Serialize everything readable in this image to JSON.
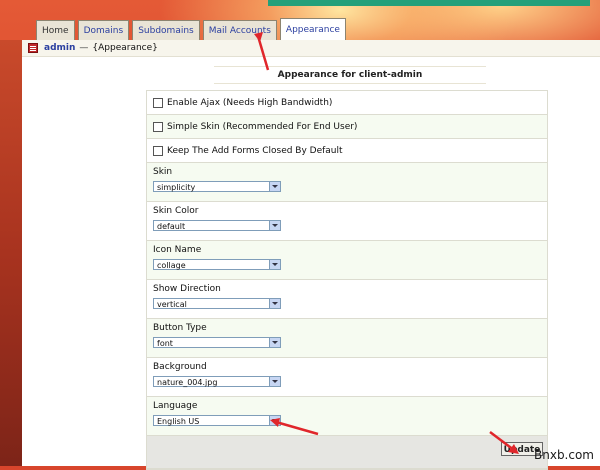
{
  "tabs": [
    {
      "label": "Home"
    },
    {
      "label": "Domains"
    },
    {
      "label": "Subdomains"
    },
    {
      "label": "Mail Accounts"
    },
    {
      "label": "Appearance",
      "active": true
    }
  ],
  "breadcrumb": {
    "user": "admin",
    "separator": "—",
    "section": "{Appearance}"
  },
  "page_title": "Appearance for client-admin",
  "checkboxes": [
    {
      "label": "Enable Ajax (Needs High Bandwidth)",
      "checked": false
    },
    {
      "label": "Simple Skin (Recommended For End User)",
      "checked": false
    },
    {
      "label": "Keep The Add Forms Closed By Default",
      "checked": false
    }
  ],
  "fields": [
    {
      "label": "Skin",
      "value": "simplicity"
    },
    {
      "label": "Skin Color",
      "value": "default"
    },
    {
      "label": "Icon Name",
      "value": "collage"
    },
    {
      "label": "Show Direction",
      "value": "vertical"
    },
    {
      "label": "Button Type",
      "value": "font"
    },
    {
      "label": "Background",
      "value": "nature_004.jpg"
    },
    {
      "label": "Language",
      "value": "English US"
    }
  ],
  "update_label": "Update",
  "watermark": "Bnxb.com",
  "colors": {
    "annotation_arrow": "#e0262b",
    "tab_link": "#2b3fa0",
    "top_strip": "#24a07a"
  }
}
